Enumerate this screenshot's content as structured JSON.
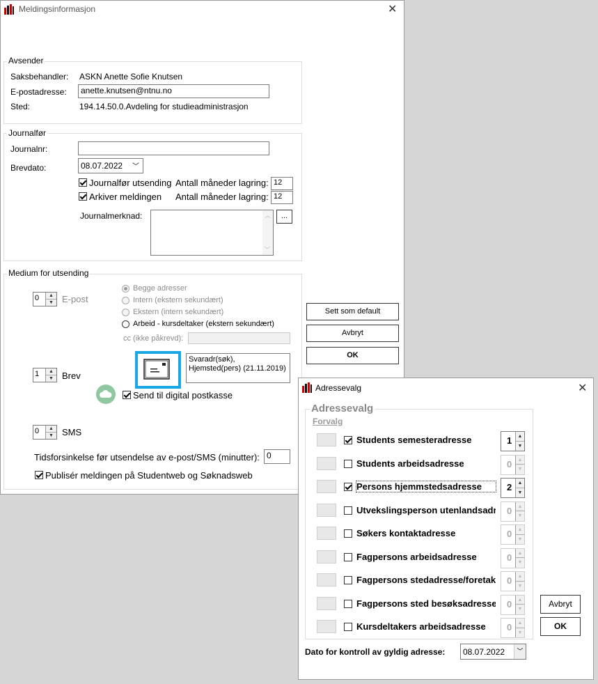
{
  "main_window": {
    "title": "Meldingsinformasjon",
    "avsender": {
      "legend": "Avsender",
      "saksbehandler_label": "Saksbehandler:",
      "saksbehandler_value": "ASKN Anette Sofie Knutsen",
      "epost_label": "E-postadresse:",
      "epost_value": "anette.knutsen@ntnu.no",
      "sted_label": "Sted:",
      "sted_value": "194.14.50.0.Avdeling for studieadministrasjon"
    },
    "journal": {
      "legend": "Journalfør",
      "journalnr_label": "Journalnr:",
      "journalnr_value": "",
      "brevdato_label": "Brevdato:",
      "brevdato_value": "08.07.2022",
      "journalfor_label": "Journalfør utsending",
      "arkiver_label": "Arkiver meldingen",
      "antall_label1": "Antall måneder lagring:",
      "antall_value1": "12",
      "antall_label2": "Antall måneder lagring:",
      "antall_value2": "12",
      "merknad_label": "Journalmerknad:",
      "dots_label": "..."
    },
    "medium": {
      "legend": "Medium for utsending",
      "epost_count": "0",
      "epost_label": "E-post",
      "radio_begge": "Begge adresser",
      "radio_intern": "Intern (ekstern sekundært)",
      "radio_ekstern": "Ekstern (intern sekundært)",
      "radio_arbeid": "Arbeid - kursdeltaker (ekstern sekundært)",
      "cc_label": "cc (ikke påkrevd):",
      "brev_count": "1",
      "brev_label": "Brev",
      "brev_address": "Svaradr(søk), Hjemsted(pers) (21.11.2019)",
      "digital_label": "Send til digital postkasse",
      "sms_count": "0",
      "sms_label": "SMS",
      "delay_label": "Tidsforsinkelse før utsendelse av e-post/SMS (minutter):",
      "delay_value": "0",
      "publiser_label": "Publisér meldingen på Studentweb og Søknadsweb"
    },
    "buttons": {
      "default": "Sett som default",
      "avbryt": "Avbryt",
      "ok": "OK"
    }
  },
  "address_window": {
    "title": "Adressevalg",
    "group_title": "Adressevalg",
    "forvalg": "Forvalg",
    "rows": [
      {
        "label": "Students semesteradresse",
        "checked": true,
        "value": "1",
        "enabled": true
      },
      {
        "label": "Students arbeidsadresse",
        "checked": false,
        "value": "0",
        "enabled": false
      },
      {
        "label": "Persons hjemmstedsadresse",
        "checked": true,
        "value": "2",
        "enabled": true
      },
      {
        "label": "Utvekslingsperson utenlandsadr",
        "checked": false,
        "value": "0",
        "enabled": false
      },
      {
        "label": "Søkers kontaktadresse",
        "checked": false,
        "value": "0",
        "enabled": false
      },
      {
        "label": "Fagpersons arbeidsadresse",
        "checked": false,
        "value": "0",
        "enabled": false
      },
      {
        "label": "Fagpersons stedadresse/foretak",
        "checked": false,
        "value": "0",
        "enabled": false
      },
      {
        "label": "Fagpersons sted besøksadresse",
        "checked": false,
        "value": "0",
        "enabled": false
      },
      {
        "label": "Kursdeltakers arbeidsadresse",
        "checked": false,
        "value": "0",
        "enabled": false
      }
    ],
    "avbryt": "Avbryt",
    "ok": "OK",
    "dato_label": "Dato for kontroll av gyldig adresse:",
    "dato_value": "08.07.2022"
  }
}
